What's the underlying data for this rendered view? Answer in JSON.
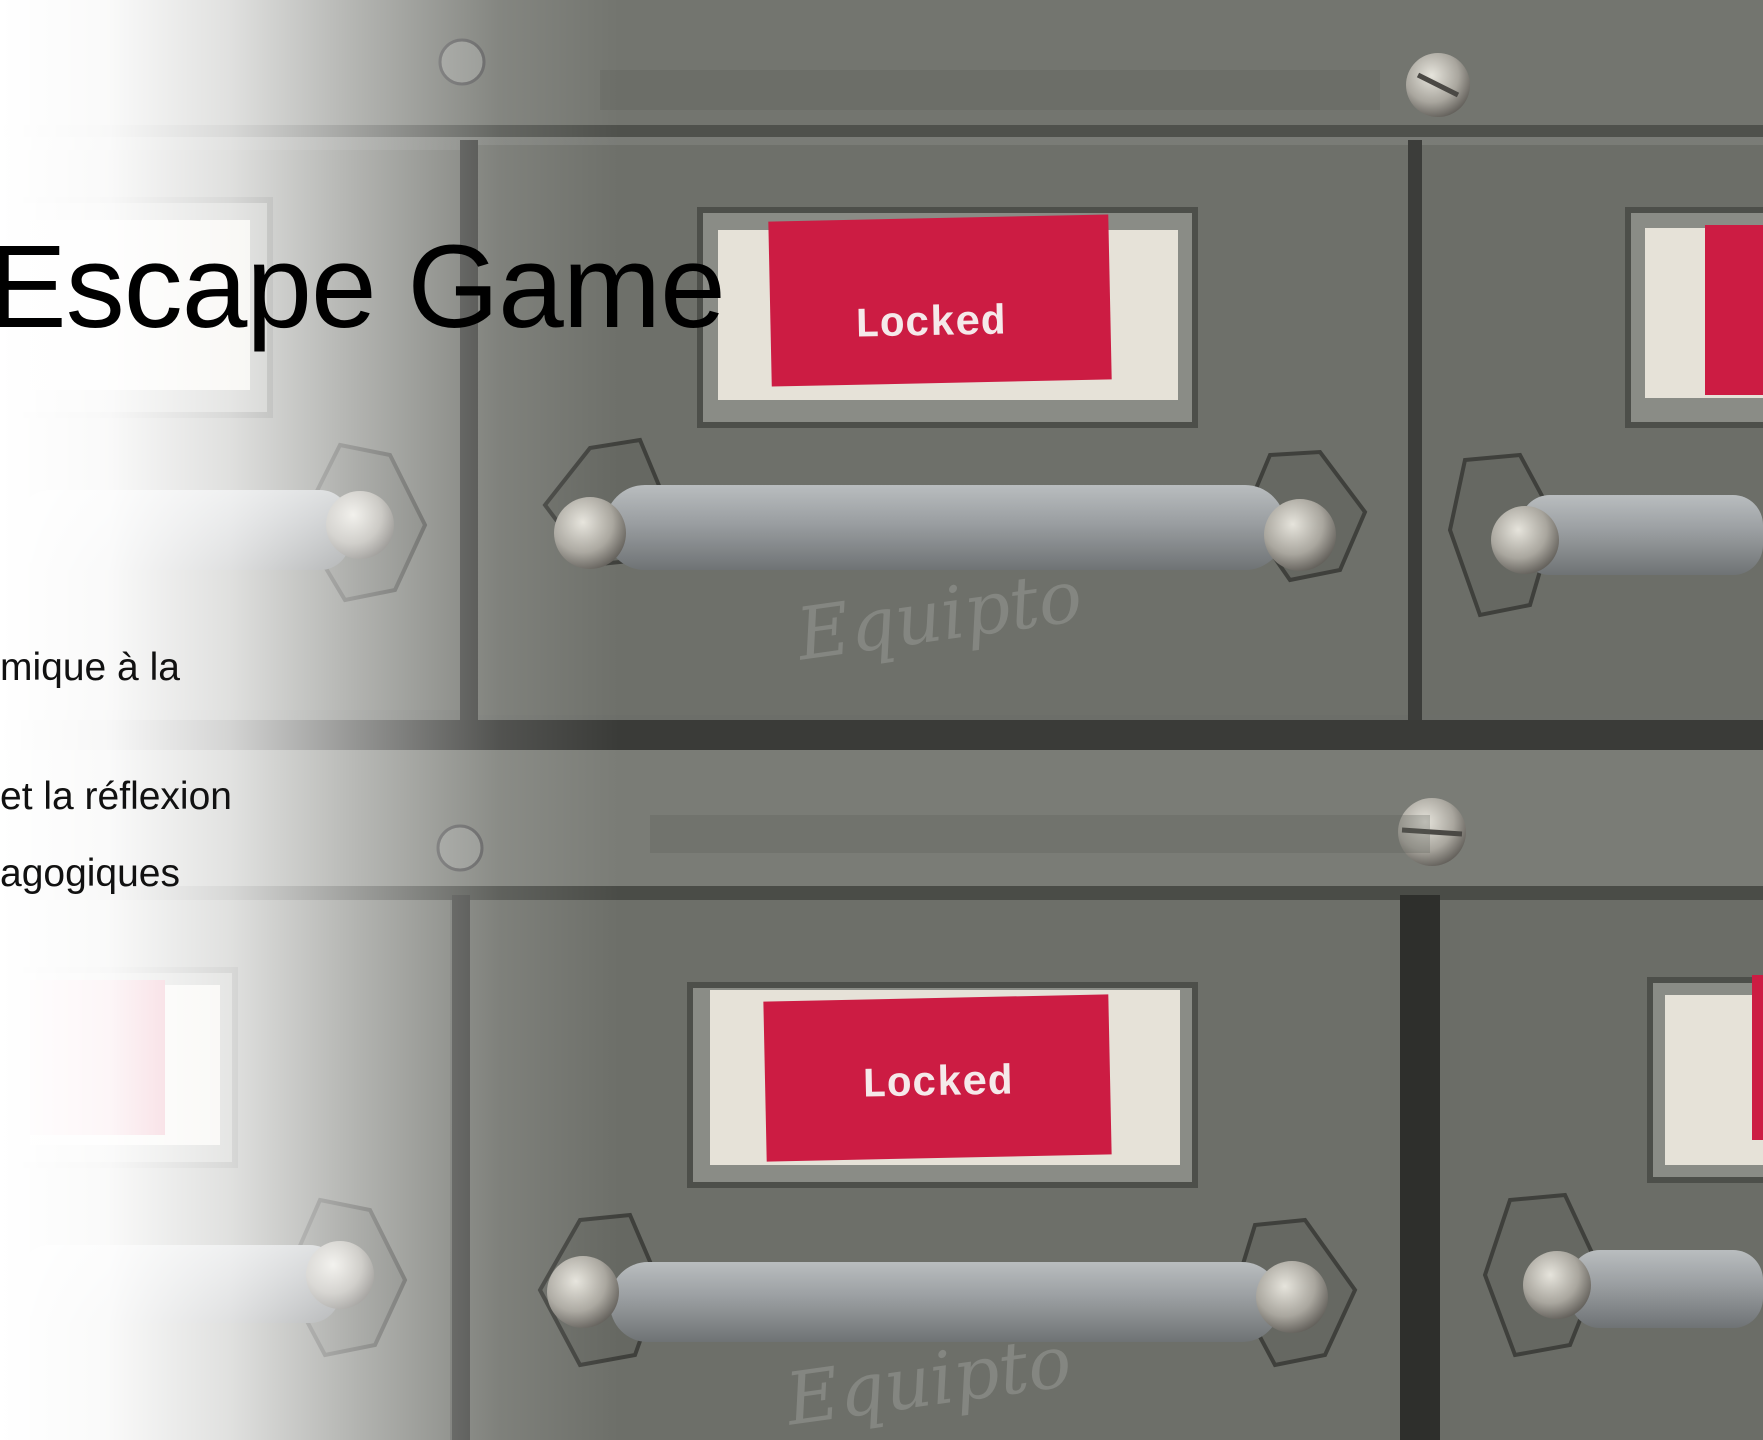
{
  "slide": {
    "title": "Escape Game",
    "bullets": [
      "mique à la",
      "et la réflexion",
      "agogiques"
    ],
    "drawer_labels": [
      "Locked",
      "Locked"
    ],
    "brand_script": [
      "Equipto",
      "Equipto"
    ]
  },
  "colors": {
    "label_red": "#cc1c43",
    "metal_gray": "#6f716d",
    "text": "#000000"
  }
}
